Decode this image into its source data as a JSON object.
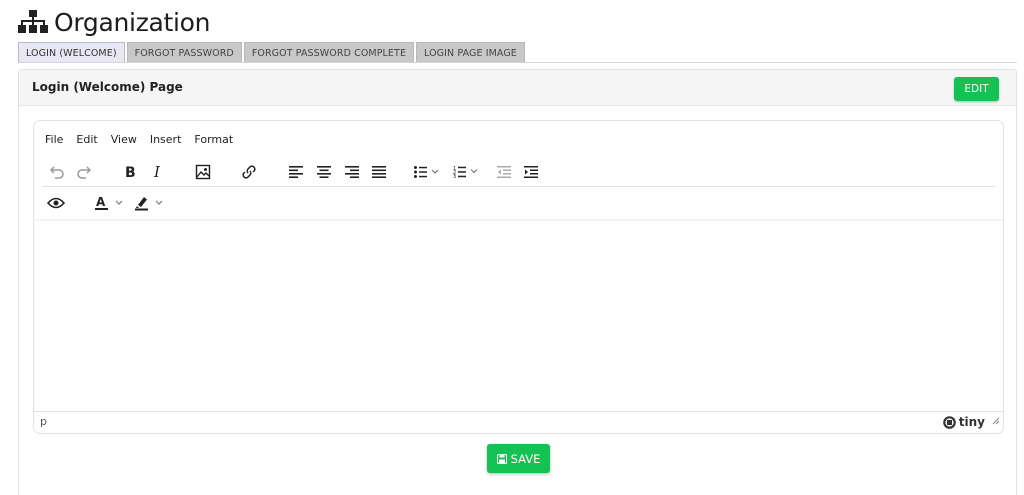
{
  "header": {
    "title": "Organization",
    "icon": "sitemap-icon"
  },
  "tabs": [
    {
      "label": "LOGIN (WELCOME)",
      "active": true
    },
    {
      "label": "FORGOT PASSWORD",
      "active": false
    },
    {
      "label": "FORGOT PASSWORD COMPLETE",
      "active": false
    },
    {
      "label": "LOGIN PAGE IMAGE",
      "active": false
    }
  ],
  "panel": {
    "title": "Login (Welcome) Page",
    "edit_label": "EDIT"
  },
  "editor": {
    "menu": [
      "File",
      "Edit",
      "View",
      "Insert",
      "Format"
    ],
    "toolbar_icons": [
      "undo-icon",
      "redo-icon",
      "bold-icon",
      "italic-icon",
      "image-icon",
      "link-icon",
      "align-left-icon",
      "align-center-icon",
      "align-right-icon",
      "align-justify-icon",
      "bullet-list-icon",
      "numbered-list-icon",
      "outdent-icon",
      "indent-icon",
      "preview-icon",
      "text-color-icon",
      "highlight-color-icon"
    ],
    "status_path": "p",
    "brand": "tiny"
  },
  "save_label": "SAVE",
  "colors": {
    "accent": "#14c254",
    "tab_active": "#e8e8f4",
    "tab_inactive": "#c8c8c8"
  }
}
